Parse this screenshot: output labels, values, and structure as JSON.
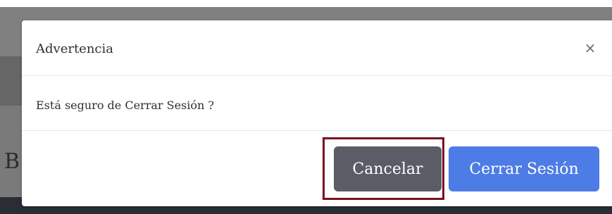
{
  "background": {
    "partial_letter": "B"
  },
  "modal": {
    "title": "Advertencia",
    "close_symbol": "×",
    "message": "Está seguro de Cerrar Sesión ?",
    "buttons": {
      "cancel_label": "Cancelar",
      "logout_label": "Cerrar Sesión"
    }
  },
  "colors": {
    "cancel_button": "#5a5d66",
    "logout_button": "#4d7ce6",
    "highlight_border": "#7a1020"
  },
  "icons": {
    "close": "close-icon"
  }
}
